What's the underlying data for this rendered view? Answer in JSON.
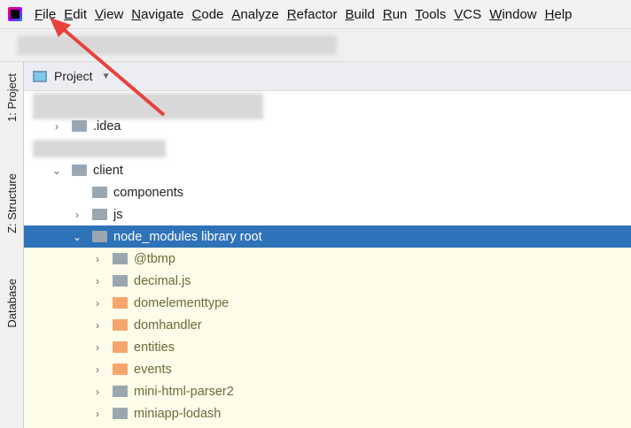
{
  "menu": [
    "File",
    "Edit",
    "View",
    "Navigate",
    "Code",
    "Analyze",
    "Refactor",
    "Build",
    "Run",
    "Tools",
    "VCS",
    "Window",
    "Help"
  ],
  "side_tabs": {
    "project": "1: Project",
    "structure": "Z: Structure",
    "database": "Database"
  },
  "panel": {
    "title": "Project"
  },
  "tree": [
    {
      "label": ".idea",
      "expanded": false,
      "folder": "gray"
    },
    {
      "label": "client",
      "expanded": true,
      "folder": "gray"
    },
    {
      "label": "components",
      "folder": "gray"
    },
    {
      "label": "js",
      "expanded": false,
      "folder": "gray"
    },
    {
      "label": "node_modules  library root",
      "expanded": true,
      "selected": true,
      "folder": "gray"
    },
    {
      "label": "@tbmp",
      "folder": "gray"
    },
    {
      "label": "decimal.js",
      "folder": "gray"
    },
    {
      "label": "domelementtype",
      "folder": "orange"
    },
    {
      "label": "domhandler",
      "folder": "orange"
    },
    {
      "label": "entities",
      "folder": "orange"
    },
    {
      "label": "events",
      "folder": "orange"
    },
    {
      "label": "mini-html-parser2",
      "folder": "gray"
    },
    {
      "label": "miniapp-lodash",
      "folder": "gray"
    }
  ],
  "colors": {
    "selection": "#2e72b8",
    "arrow": "#e8413c",
    "library_bg": "#fdfce9"
  }
}
